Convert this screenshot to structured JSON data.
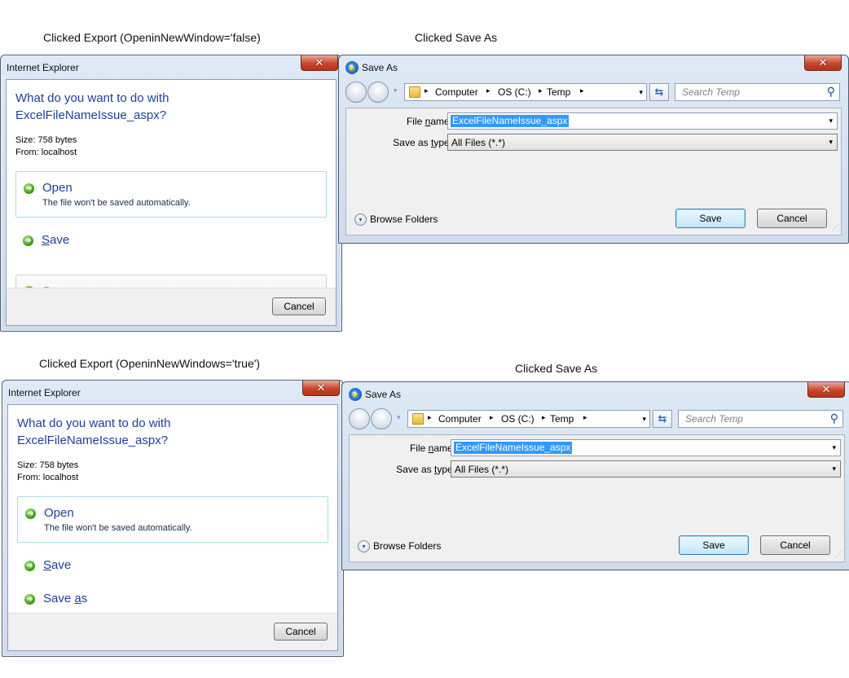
{
  "captions": {
    "top_left": "Clicked Export (OpeninNewWindow='false)",
    "top_right": "Clicked Save As",
    "bottom_left": "Clicked Export (OpeninNewWindows='true')",
    "bottom_right": "Clicked Save As"
  },
  "download_dialog": {
    "title": "Internet Explorer",
    "close_glyph": "✕",
    "question_line1": "What do you want to do with",
    "question_line2": "ExcelFileNameIssue_aspx?",
    "size": "Size: 758 bytes",
    "from": "From: localhost",
    "open_label": "Open",
    "open_sub": "The file won't be saved automatically.",
    "save_label_prefix": "",
    "save_label_u": "S",
    "save_label_rest": "ave",
    "saveas_label_prefix": "Save ",
    "saveas_label_u": "a",
    "saveas_label_rest": "s",
    "arrow_glyph": "➜",
    "cancel": "Cancel",
    "icons": {
      "option": "green-arrow-icon"
    }
  },
  "save_as_dialog": {
    "title": "Save As",
    "close_glyph": "✕",
    "breadcrumbs": [
      "Computer",
      "OS (C:)",
      "Temp"
    ],
    "crumb_arrow": "▸",
    "drop_glyph": "▾",
    "search_placeholder": "Search Temp",
    "filename_label_prefix": "File ",
    "filename_label_u": "n",
    "filename_label_rest": "ame:",
    "filename_value": "ExcelFileNameIssue_aspx",
    "type_label_prefix": "Save as ",
    "type_label_u": "t",
    "type_label_rest": "ype:",
    "type_value": "All Files (*.*)",
    "browse_folders": "Browse Folders",
    "save": "Save",
    "cancel": "Cancel",
    "icons": {
      "logo": "ie-logo-icon",
      "refresh": "refresh-icon",
      "search": "search-icon"
    }
  }
}
